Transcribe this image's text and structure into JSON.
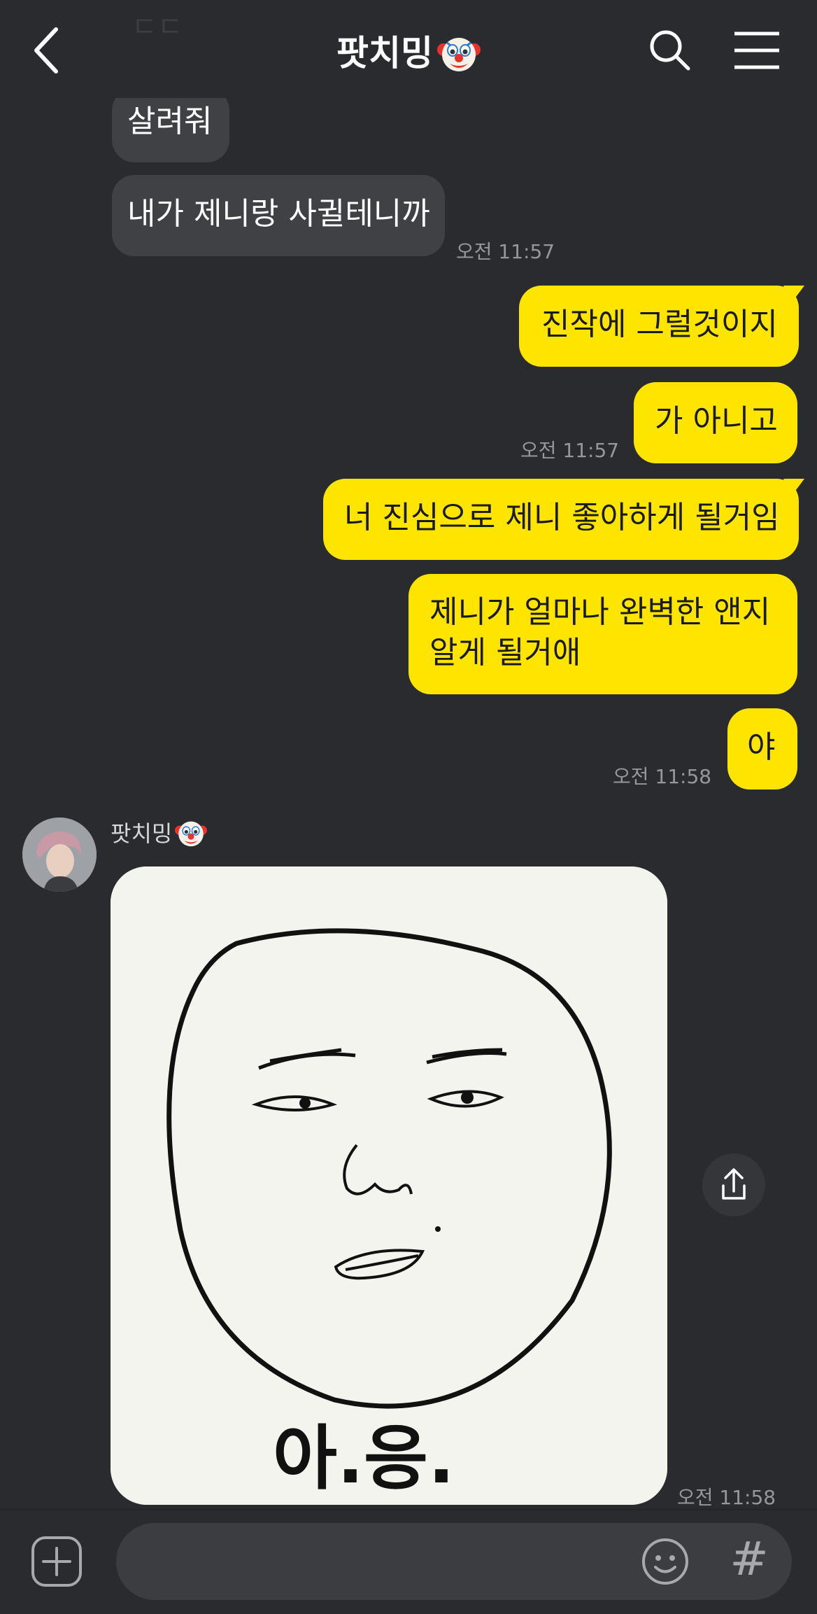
{
  "header": {
    "title": "팟치밍",
    "title_emoji": "clown-face-emoji",
    "ghost_text": "ㄷㄷ",
    "icons": [
      "back-arrow-icon",
      "search-icon",
      "menu-icon"
    ]
  },
  "messages": [
    {
      "from": "them",
      "text": "살려줘"
    },
    {
      "from": "them",
      "text": "내가 제니랑 사귈테니까",
      "time": "오전 11:57"
    },
    {
      "from": "me",
      "text": "진작에 그럴것이지"
    },
    {
      "from": "me",
      "text": "가 아니고",
      "time": "오전 11:57"
    },
    {
      "from": "me",
      "text": "너 진심으로 제니 좋아하게 될거임"
    },
    {
      "from": "me",
      "lines": [
        "제니가 얼마나 완벽한 앤지",
        "알게 될거애"
      ]
    },
    {
      "from": "me",
      "text": "야",
      "time": "오전 11:58"
    }
  ],
  "image_message": {
    "sender_name": "팟치밍",
    "sender_emoji": "clown-face-emoji",
    "image_caption": "아.응.",
    "time": "오전 11:58",
    "icons": [
      "share-icon"
    ]
  },
  "input_bar": {
    "placeholder": "",
    "icons": [
      "plus-icon",
      "emoji-icon",
      "hash-icon"
    ],
    "hash_glyph": "#"
  },
  "colors": {
    "background": "#2a2b2e",
    "incoming_bubble": "#404144",
    "outgoing_bubble": "#fee500",
    "timestamp": "#96979b"
  }
}
